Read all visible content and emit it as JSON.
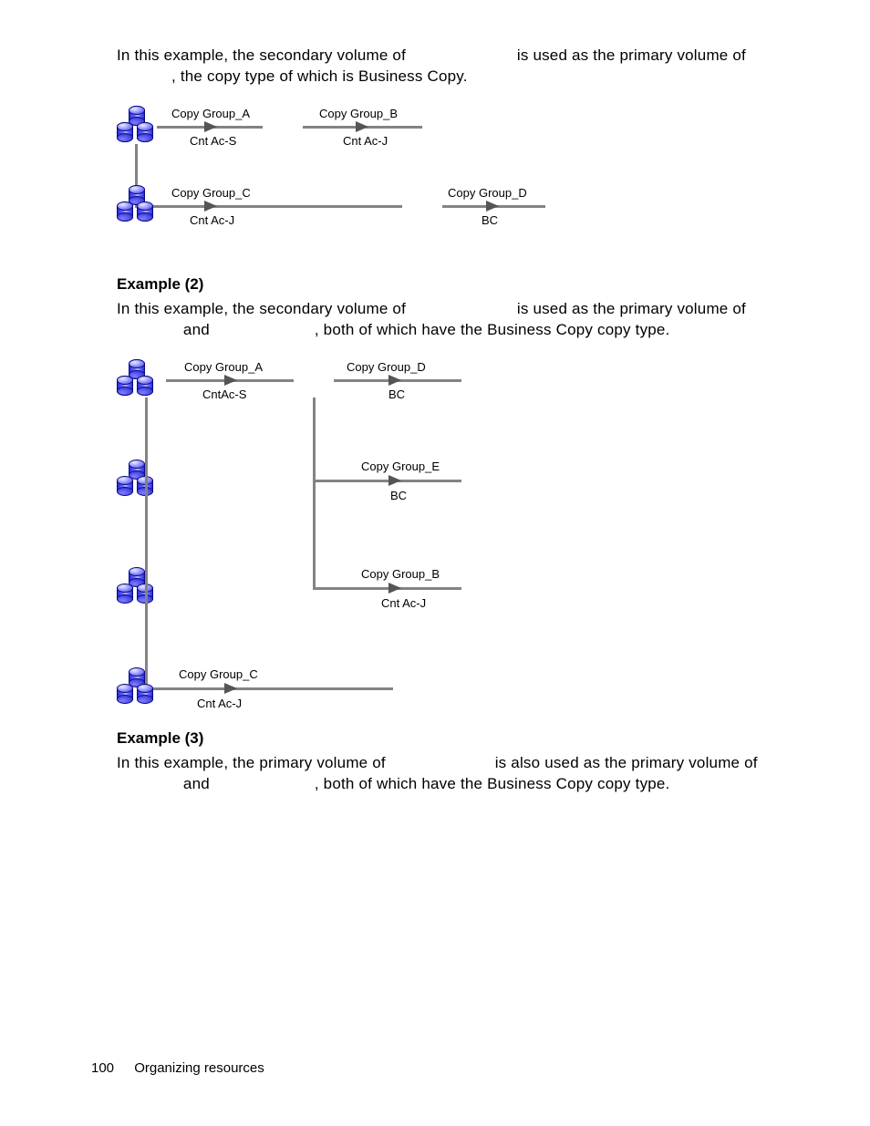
{
  "footer": {
    "page_number": "100",
    "section": "Organizing resources"
  },
  "ex1": {
    "para_a": "In this example, the secondary volume of ",
    "para_b": " is used as the primary volume of ",
    "para_c": ", the copy type of which is Business Copy.",
    "labels": {
      "cga": "Copy Group_A",
      "cgb": "Copy Group_B",
      "cgc": "Copy Group_C",
      "cgd": "Copy Group_D",
      "cntacs": "Cnt Ac-S",
      "cntacj1": "Cnt Ac-J",
      "cntacj2": "Cnt Ac-J",
      "bc": "BC"
    }
  },
  "ex2": {
    "heading": "Example (2)",
    "para_a": "In this example, the secondary volume of ",
    "para_b": " is used as the primary volume of ",
    "para_c": " and ",
    "para_d": ", both of which have the Business Copy copy type.",
    "labels": {
      "cga": "Copy Group_A",
      "cgd": "Copy Group_D",
      "cge": "Copy Group_E",
      "cgb": "Copy Group_B",
      "cgc": "Copy Group_C",
      "cntacs": "CntAc-S",
      "cntacj1": "Cnt Ac-J",
      "cntacj2": "Cnt Ac-J",
      "bc1": "BC",
      "bc2": "BC"
    }
  },
  "ex3": {
    "heading": "Example (3)",
    "para_a": "In this example, the primary volume of ",
    "para_b": " is also used as the primary volume of ",
    "para_c": " and ",
    "para_d": ", both of which have the Business Copy copy type."
  }
}
